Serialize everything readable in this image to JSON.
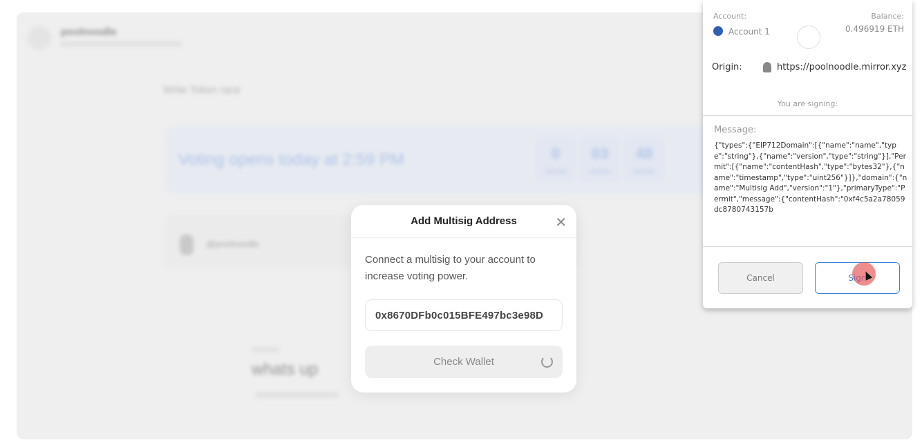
{
  "background": {
    "publication_name": "poolnoodle",
    "subtitle": "Write Token race",
    "voting_text": "Voting opens today at 2:59 PM",
    "countdown": [
      "0",
      "03",
      "48"
    ],
    "author_name": "@poolnoodle",
    "post_title": "whats up"
  },
  "modal": {
    "title": "Add Multisig Address",
    "description": "Connect a multisig to your account to increase voting power.",
    "address_value": "0x8670DFb0c015BFE497bc3e98D",
    "check_button": "Check Wallet"
  },
  "wallet": {
    "account_label": "Account:",
    "account_name": "Account 1",
    "balance_label": "Balance:",
    "balance": "0.496919 ETH",
    "origin_label": "Origin:",
    "origin": "https://poolnoodle.mirror.xyz",
    "signing_label": "You are signing:",
    "message_label": "Message:",
    "message": "{\"types\":{\"EIP712Domain\":[{\"name\":\"name\",\"type\":\"string\"},{\"name\":\"version\",\"type\":\"string\"}],\"Permit\":[{\"name\":\"contentHash\",\"type\":\"bytes32\"},{\"name\":\"timestamp\",\"type\":\"uint256\"}]},\"domain\":{\"name\":\"Multisig Add\",\"version\":\"1\"},\"primaryType\":\"Permit\",\"message\":{\"contentHash\":\"0xf4c5a2a78059dc8780743157b",
    "cancel_button": "Cancel",
    "sign_button": "Sign",
    "account_color": "#2f5fb3",
    "accent_color": "#3b82e0"
  }
}
